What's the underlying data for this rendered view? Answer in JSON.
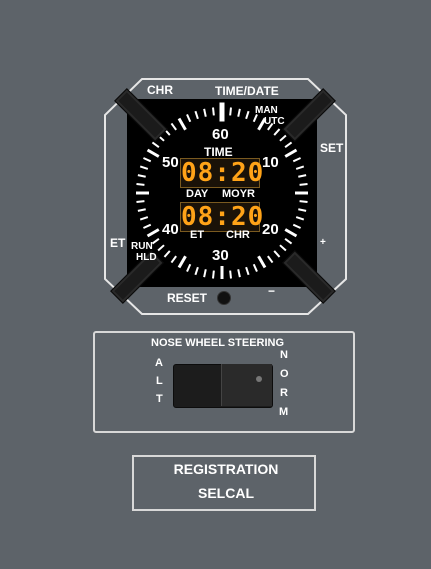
{
  "clock": {
    "chr_label": "CHR",
    "time_date_label": "TIME/DATE",
    "man_label": "MAN",
    "utc_label": "UTC",
    "set_label": "SET",
    "et_label": "ET",
    "run_label": "RUN",
    "hld_label": "HLD",
    "reset_label": "RESET",
    "plus_label": "+",
    "minus_label": "−",
    "face": {
      "time_label": "TIME",
      "time_display": "08:20",
      "day_label": "DAY",
      "moyr_label": "MOYR",
      "chrono_display": "08:20",
      "et_label": "ET",
      "chr_label": "CHR",
      "dial": [
        "60",
        "10",
        "20",
        "30",
        "40",
        "50"
      ]
    }
  },
  "nose_wheel_steering": {
    "title": "NOSE WHEEL STEERING",
    "alt_letters": [
      "A",
      "L",
      "T"
    ],
    "norm_letters": [
      "N",
      "O",
      "R",
      "M"
    ]
  },
  "registration": {
    "line1": "REGISTRATION",
    "line2": "SELCAL"
  },
  "colors": {
    "panel": "#5d6369",
    "display": "#ffa318",
    "face": "#000000"
  }
}
